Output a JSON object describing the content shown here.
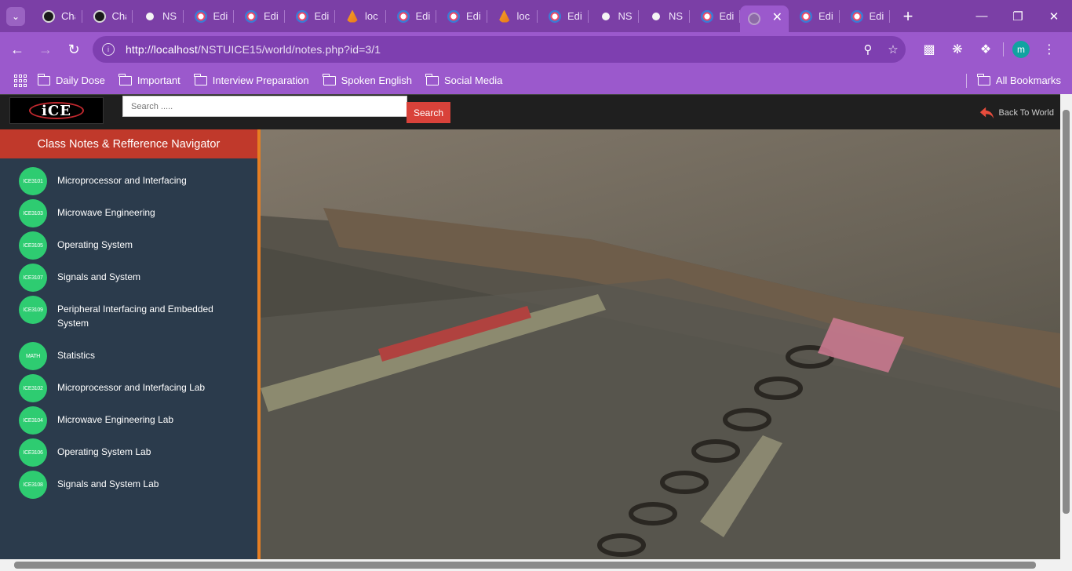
{
  "browser": {
    "tabs": [
      {
        "title": "Cha",
        "favicon": "chatgpt-icon"
      },
      {
        "title": "Cha",
        "favicon": "chatgpt-icon"
      },
      {
        "title": "NST",
        "favicon": "nst-icon"
      },
      {
        "title": "Edit",
        "favicon": "edit-icon"
      },
      {
        "title": "Edit",
        "favicon": "edit-icon"
      },
      {
        "title": "Edit",
        "favicon": "edit-icon"
      },
      {
        "title": "loc",
        "favicon": "xampp-icon"
      },
      {
        "title": "Edit",
        "favicon": "edit-icon"
      },
      {
        "title": "Edit",
        "favicon": "edit-icon"
      },
      {
        "title": "loc",
        "favicon": "xampp-icon"
      },
      {
        "title": "Edit",
        "favicon": "edit-icon"
      },
      {
        "title": "NST",
        "favicon": "nst-icon"
      },
      {
        "title": "NST",
        "favicon": "nst-icon"
      },
      {
        "title": "Edit",
        "favicon": "edit-icon"
      },
      {
        "title": "",
        "favicon": "loading-icon",
        "active": true
      },
      {
        "title": "Edit",
        "favicon": "edit-icon"
      },
      {
        "title": "Edit",
        "favicon": "edit-icon"
      }
    ],
    "url_host": "http://localhost",
    "url_rest": "/NSTUICE15/world/notes.php?id=3/1",
    "profile_initial": "m",
    "bookmarks": [
      "Daily Dose",
      "Important",
      "Interview Preparation",
      "Spoken English",
      "Social Media"
    ],
    "all_bookmarks": "All Bookmarks",
    "accent": "#9b59cc"
  },
  "site": {
    "logo_text": "iCE",
    "search_placeholder": "Search .....",
    "search_button": "Search",
    "back_link": "Back To World",
    "sidebar_title": "Class Notes & Refference Navigator",
    "courses": [
      {
        "code": "ICE3101",
        "name": "Microprocessor and Interfacing"
      },
      {
        "code": "ICE3103",
        "name": "Microwave Engineering"
      },
      {
        "code": "ICE3105",
        "name": "Operating System"
      },
      {
        "code": "ICE3107",
        "name": "Signals and System"
      },
      {
        "code": "ICE3109",
        "name": "Peripheral Interfacing and Embedded System"
      },
      {
        "code": "MATH",
        "name": "Statistics"
      },
      {
        "code": "ICE3102",
        "name": "Microprocessor and Interfacing Lab"
      },
      {
        "code": "ICE3104",
        "name": "Microwave Engineering Lab"
      },
      {
        "code": "ICE3106",
        "name": "Operating System Lab"
      },
      {
        "code": "ICE3108",
        "name": "Signals and System Lab"
      }
    ],
    "colors": {
      "header_red": "#c0392b",
      "badge_green": "#2ecc71",
      "sidebar_bg": "#2b3b4c",
      "border_orange": "#e67e22",
      "search_red": "#d9423a"
    }
  }
}
